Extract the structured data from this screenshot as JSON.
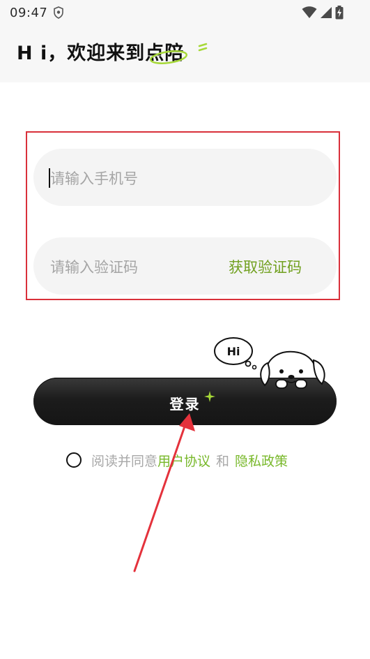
{
  "status_bar": {
    "time": "09:47",
    "icons": [
      "shield-icon",
      "wifi-icon",
      "signal-icon",
      "battery-charging-icon"
    ]
  },
  "header": {
    "greeting": "H i，欢迎来到点陪"
  },
  "form": {
    "phone_placeholder": "请输入手机号",
    "code_placeholder": "请输入验证码",
    "get_code_label": "获取验证码"
  },
  "login": {
    "label": "登录"
  },
  "mascot": {
    "bubble_text": "Hi"
  },
  "agreement": {
    "prefix": "阅读并同意",
    "user_agreement": "用户协议",
    "connector": "和",
    "privacy_policy": "隐私政策",
    "checked": false
  },
  "colors": {
    "accent_green": "#78b82a",
    "highlight_red": "#d9303a",
    "button_dark": "#1c1c1c"
  }
}
